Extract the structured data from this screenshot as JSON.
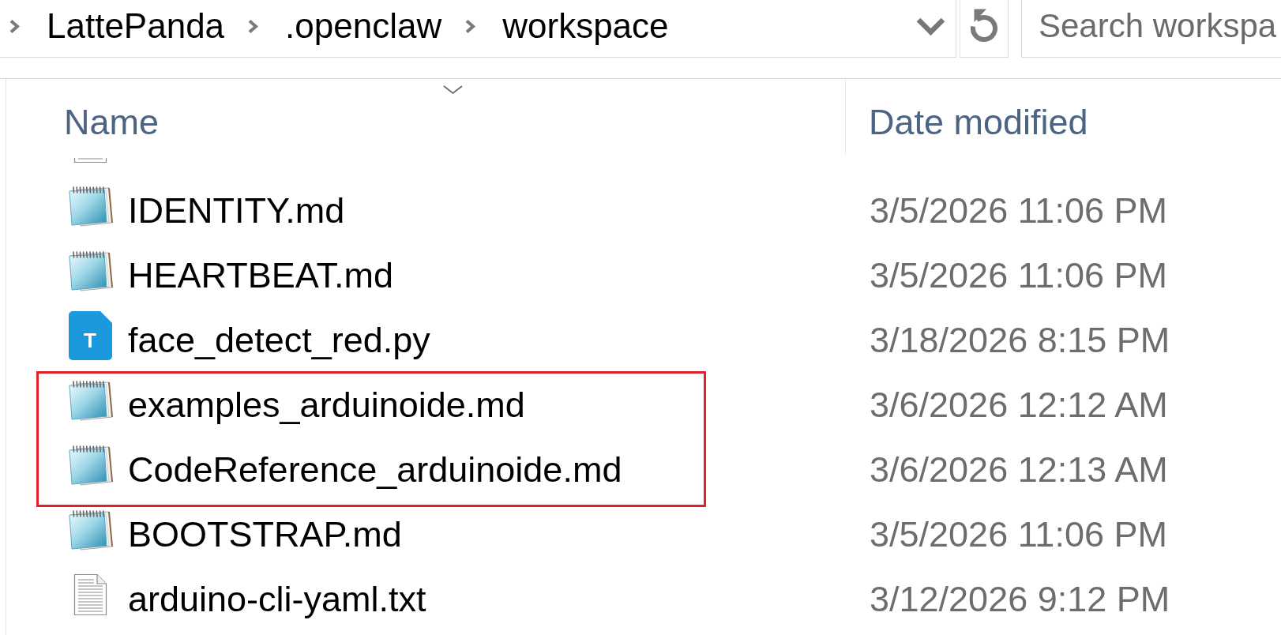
{
  "address_bar": {
    "breadcrumbs": [
      {
        "label": "LattePanda"
      },
      {
        "label": ".openclaw"
      },
      {
        "label": "workspace"
      }
    ]
  },
  "search": {
    "placeholder": "Search workspa"
  },
  "columns": [
    {
      "label": "Name",
      "sorted": true
    },
    {
      "label": "Date modified",
      "sorted": false
    }
  ],
  "partial_row_above": {
    "kind": "page"
  },
  "files": [
    {
      "name": "IDENTITY.md",
      "date": "3/5/2026 11:06 PM",
      "kind": "notepad",
      "highlighted": false
    },
    {
      "name": "HEARTBEAT.md",
      "date": "3/5/2026 11:06 PM",
      "kind": "notepad",
      "highlighted": false
    },
    {
      "name": "face_detect_red.py",
      "date": "3/18/2026 8:15 PM",
      "kind": "letter-tile",
      "icon_letter": "T",
      "highlighted": false
    },
    {
      "name": "examples_arduinoide.md",
      "date": "3/6/2026 12:12 AM",
      "kind": "notepad",
      "highlighted": true
    },
    {
      "name": "CodeReference_arduinoide.md",
      "date": "3/6/2026 12:13 AM",
      "kind": "notepad",
      "highlighted": true
    },
    {
      "name": "BOOTSTRAP.md",
      "date": "3/5/2026 11:06 PM",
      "kind": "notepad",
      "highlighted": false
    },
    {
      "name": "arduino-cli-yaml.txt",
      "date": "3/12/2026 9:12 PM",
      "kind": "page",
      "highlighted": false
    }
  ]
}
